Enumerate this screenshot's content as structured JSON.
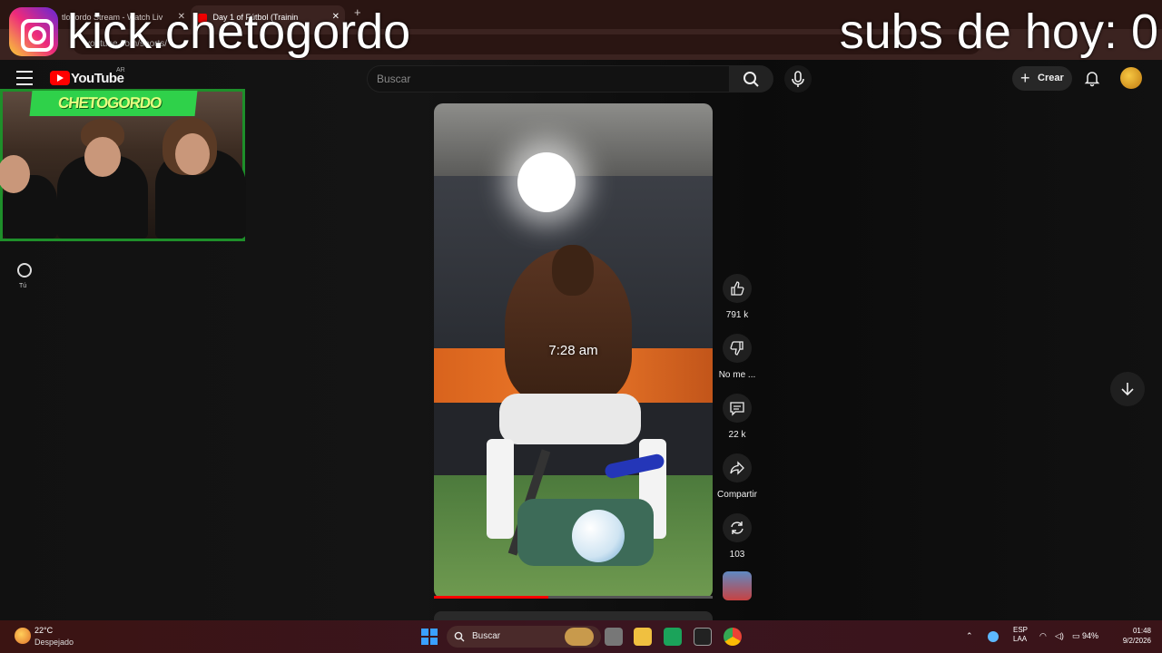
{
  "browser": {
    "tabs": [
      {
        "title": "tlogordo Stream - Watch Liv"
      },
      {
        "title": "Day 1 of Fútbol (Trainin"
      }
    ],
    "new_tab": "+",
    "address": "youtube.com/shorts/"
  },
  "overlay": {
    "instagram_handle": "kick.chetogordo",
    "subs_counter": "subs de hoy: 0"
  },
  "youtube": {
    "logo_text": "YouTube",
    "region": "AR",
    "search_placeholder": "Buscar",
    "create_label": "Crear",
    "you_label": "Tú"
  },
  "webcam": {
    "streamer_name": "CHETOGORDO"
  },
  "short": {
    "overlay_time": "7:28 am",
    "progress": 0.41,
    "actions": {
      "like_count": "791 k",
      "dislike_label": "No me ...",
      "comments_count": "22 k",
      "share_label": "Compartir",
      "remix_count": "103"
    }
  },
  "taskbar": {
    "temperature": "22°C",
    "weather": "Despejado",
    "search_label": "Buscar",
    "language_top": "ESP",
    "language_bottom": "LAA",
    "battery": "94%",
    "time": "01:48",
    "date": "9/2/2026"
  },
  "colors": {
    "youtube_red": "#ff0000",
    "stream_green": "#2fd14a",
    "taskbar": "#3b1412"
  }
}
